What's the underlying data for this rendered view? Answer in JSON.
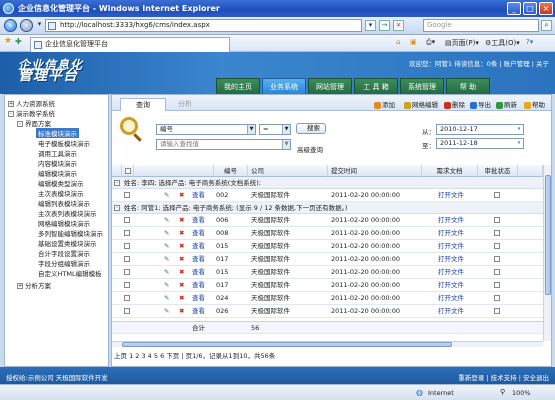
{
  "window": {
    "title": "企业信息化管理平台 - Windows Internet Explorer",
    "min": "_",
    "max": "□",
    "close": "×"
  },
  "address": {
    "url": "http://localhost:3333/hxg6/cms/index.aspx",
    "search_placeholder": "Google",
    "go_glyph": "→",
    "stop_glyph": "×"
  },
  "favbar": {
    "tab_title": "企业信息化管理平台",
    "page_menu": "页面(P)",
    "tools_menu": "工具(O)"
  },
  "app": {
    "logo_line1": "企业信息化",
    "logo_line2": "管理平台",
    "welcome": "欢迎您：阿管1 待读信息：0条 | 账户管理 | 关于",
    "nav": [
      "我的主页",
      "业务系统",
      "网站管理",
      "工 具 箱",
      "系统管理",
      "帮 助"
    ],
    "nav_active": 1
  },
  "sidebar": {
    "items": [
      {
        "label": "人力资源系统",
        "level": 0,
        "toggle": "+"
      },
      {
        "label": "演示教学系统",
        "level": 0,
        "toggle": "-"
      },
      {
        "label": "界面方案",
        "level": 1,
        "toggle": "-"
      },
      {
        "label": "标准模块演示",
        "level": 2,
        "selected": true
      },
      {
        "label": "电子模板模块演示",
        "level": 2
      },
      {
        "label": "调用工具演示",
        "level": 2
      },
      {
        "label": "内容模块演示",
        "level": 2
      },
      {
        "label": "编辑模块演示",
        "level": 2
      },
      {
        "label": "编辑模类型演示",
        "level": 2
      },
      {
        "label": "主次表模块演示",
        "level": 2
      },
      {
        "label": "编辑列表模块演示",
        "level": 2
      },
      {
        "label": "主次表列表模块演示",
        "level": 2
      },
      {
        "label": "网格编辑模块演示",
        "level": 2
      },
      {
        "label": "多列智能编辑模块演示",
        "level": 2
      },
      {
        "label": "基础设置类模块演示",
        "level": 2
      },
      {
        "label": "合计字段设置演示",
        "level": 2
      },
      {
        "label": "字段分组编辑演示",
        "level": 2
      },
      {
        "label": "自定义HTML编辑模板",
        "level": 2
      },
      {
        "label": "分析方案",
        "level": 1,
        "toggle": "+"
      }
    ]
  },
  "content": {
    "tabs": [
      "查询",
      "分析"
    ],
    "tools": [
      {
        "label": "添加",
        "color": "#e88a1a"
      },
      {
        "label": "网格编辑",
        "color": "#d0a020"
      },
      {
        "label": "删除",
        "color": "#c8301c"
      },
      {
        "label": "导出",
        "color": "#2a6fc8"
      },
      {
        "label": "刷新",
        "color": "#2a9a3a"
      },
      {
        "label": "帮助",
        "color": "#e8a81a"
      }
    ],
    "search": {
      "field_value": "编号",
      "operator_value": "=",
      "input_value": "",
      "input_placeholder": "请输入查找值",
      "search_btn": "搜索",
      "advanced": "高级查询",
      "from_label": "从：",
      "from_date": "2010-12-17",
      "to_label": "至：",
      "to_date": "2011-12-18"
    },
    "columns": [
      "编号",
      "公司",
      "提交时间",
      "需求文档",
      "审批状态"
    ],
    "groups": [
      {
        "title": "姓名: 李四; 选择产品: 电子商务系统(文档系统);",
        "rows": [
          {
            "id": "002",
            "company": "天极国际软件",
            "time": "2011-02-20 00:00:00",
            "doc": "打开文件"
          }
        ]
      },
      {
        "title": "姓名: 阿管1; 选择产品: 电子商务系统; (显示 9 / 12 条数据,下一页还有数据。)",
        "rows": [
          {
            "id": "006",
            "company": "天极国际软件",
            "time": "2011-02-20 00:00:00",
            "doc": "打开文件"
          },
          {
            "id": "008",
            "company": "天极国际软件",
            "time": "2011-02-20 00:00:00",
            "doc": "打开文件"
          },
          {
            "id": "015",
            "company": "天极国际软件",
            "time": "2011-02-20 00:00:00",
            "doc": "打开文件"
          },
          {
            "id": "017",
            "company": "天极国际软件",
            "time": "2011-02-20 00:00:00",
            "doc": "打开文件"
          },
          {
            "id": "015",
            "company": "天极国际软件",
            "time": "2011-02-20 00:00:00",
            "doc": "打开文件"
          },
          {
            "id": "017",
            "company": "天极国际软件",
            "time": "2011-02-20 00:00:00",
            "doc": "打开文件"
          },
          {
            "id": "024",
            "company": "天极国际软件",
            "time": "2011-02-20 00:00:00",
            "doc": "打开文件"
          },
          {
            "id": "026",
            "company": "天极国际软件",
            "time": "2011-02-20 00:00:00",
            "doc": "打开文件"
          }
        ]
      }
    ],
    "view_label": "查看",
    "total_label": "合计",
    "total_value": "56",
    "pager": "上页 1 2 3 4 5 6 下页 | 页1/6，记录从1到10，共56条"
  },
  "footer": {
    "left": "授权给:示例公司  天极国际软件开发",
    "right": "重新登录 | 技术支持 | 安全退出"
  },
  "status": {
    "zone": "Internet",
    "zoom": "100%"
  },
  "colors": {
    "accent": "#2b73be",
    "nav_active": "#2b85d6",
    "nav_tab": "#266a42"
  }
}
